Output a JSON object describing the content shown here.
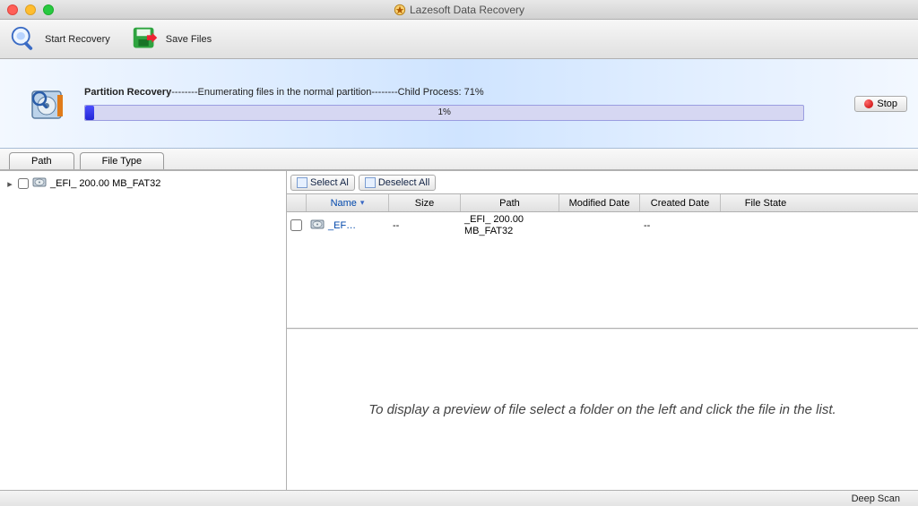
{
  "window": {
    "title": "Lazesoft Data Recovery"
  },
  "toolbar": {
    "start_recovery": "Start Recovery",
    "save_files": "Save Files"
  },
  "progress": {
    "label_bold": "Partition Recovery",
    "label_rest": "--------Enumerating files in the normal partition--------Child Process: 71%",
    "bar_percent": "1%",
    "stop_label": "Stop"
  },
  "tabs": {
    "path": "Path",
    "file_type": "File Type"
  },
  "tree": {
    "root_label": "_EFI_ 200.00 MB_FAT32"
  },
  "selection_bar": {
    "select_all": "Select Al",
    "deselect_all": "Deselect All"
  },
  "columns": {
    "name": "Name",
    "size": "Size",
    "path": "Path",
    "modified": "Modified Date",
    "created": "Created Date",
    "state": "File State"
  },
  "rows": [
    {
      "name": "_EF…",
      "size": "--",
      "path": "_EFI_ 200.00 MB_FAT32",
      "modified": "",
      "created": "--",
      "state": ""
    }
  ],
  "preview_hint": "To display a preview of file select a folder on the left and click the file in the list.",
  "status": {
    "mode": "Deep Scan"
  }
}
